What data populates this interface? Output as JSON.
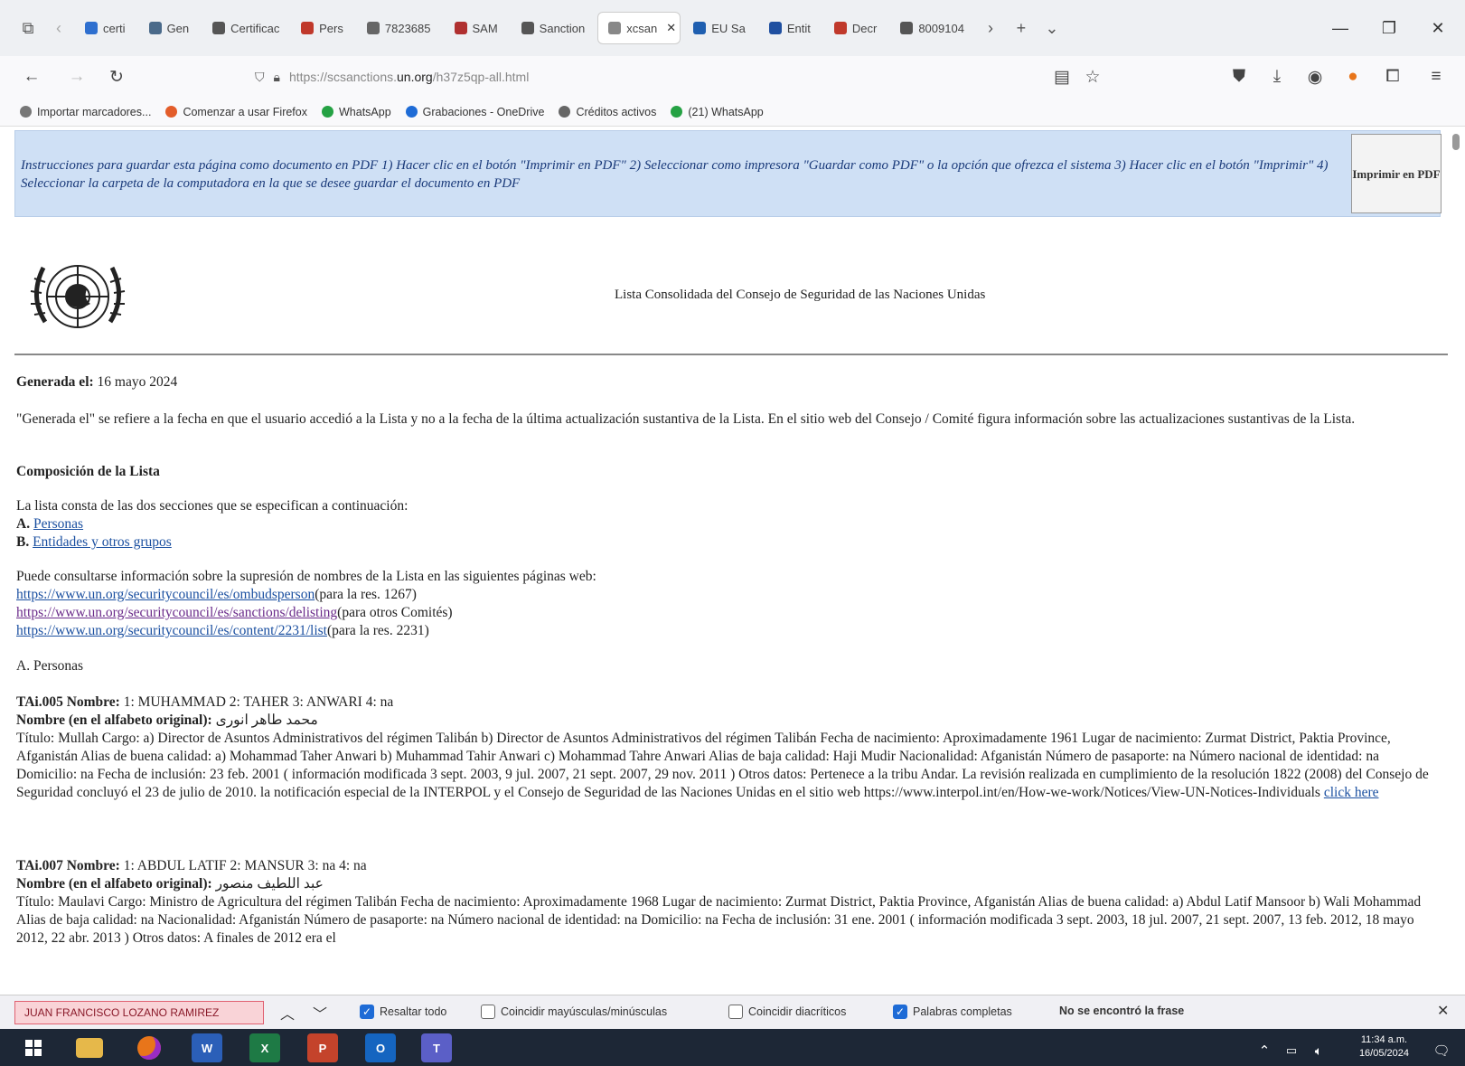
{
  "browser": {
    "tabs": [
      {
        "label": "certi",
        "fav": "#2e6fcf"
      },
      {
        "label": "Gen",
        "fav": "#4a6a8a"
      },
      {
        "label": "Certificac",
        "fav": "#555555"
      },
      {
        "label": "Pers",
        "fav": "#c0392b"
      },
      {
        "label": "7823685",
        "fav": "#666666"
      },
      {
        "label": "SAM",
        "fav": "#b03030"
      },
      {
        "label": "Sanction",
        "fav": "#555555"
      },
      {
        "label": "xcsan",
        "fav": "#888888",
        "active": true
      },
      {
        "label": "EU Sa",
        "fav": "#1f5fb0"
      },
      {
        "label": "Entit",
        "fav": "#1f4fa0"
      },
      {
        "label": "Decr",
        "fav": "#c0392b"
      },
      {
        "label": "8009104",
        "fav": "#555555"
      }
    ],
    "url_prefix": "https://scsanctions.",
    "url_domain": "un.org",
    "url_suffix": "/h37z5qp-all.html",
    "bookmarks": [
      {
        "label": "Importar marcadores...",
        "color": "#777777"
      },
      {
        "label": "Comenzar a usar Firefox",
        "color": "#e35d2a"
      },
      {
        "label": "WhatsApp",
        "color": "#25a244"
      },
      {
        "label": "Grabaciones - OneDrive",
        "color": "#1e6bd6"
      },
      {
        "label": "Créditos activos",
        "color": "#666666"
      },
      {
        "label": "(21) WhatsApp",
        "color": "#25a244"
      }
    ]
  },
  "page": {
    "instructions": "Instrucciones para guardar esta página como documento en PDF 1) Hacer clic en el botón \"Imprimir en PDF\" 2) Seleccionar como impresora \"Guardar como PDF\" o la opción que ofrezca el sistema 3) Hacer clic en el botón \"Imprimir\" 4) Seleccionar la carpeta de la computadora en la que se desee guardar el documento en PDF",
    "print_button": "Imprimir en PDF",
    "title": "Lista Consolidada del Consejo de Seguridad de las Naciones Unidas",
    "generated_label": "Generada el:",
    "generated_value": "16 mayo 2024",
    "generated_note": "\"Generada el\" se refiere a la fecha en que el usuario accedió a la Lista y no a la fecha de la última actualización sustantiva de la Lista. En el sitio web del Consejo / Comité figura información sobre las actualizaciones sustantivas de la Lista.",
    "composition_heading": "Composición de la Lista",
    "composition_intro": "La lista consta de las dos secciones que se especifican a continuación:",
    "section_a_letter": "A.",
    "section_a_link": "Personas",
    "section_b_letter": "B.",
    "section_b_link": "Entidades y otros grupos",
    "removal_intro": "Puede consultarse información sobre la supresión de nombres de la Lista en las siguientes páginas web:",
    "link1": "https://www.un.org/securitycouncil/es/ombudsperson",
    "link1_note": "(para la res. 1267)",
    "link2": "https://www.un.org/securitycouncil/es/sanctions/delisting",
    "link2_note": "(para otros Comités)",
    "link3": "https://www.un.org/securitycouncil/es/content/2231/list",
    "link3_note": "(para la res. 2231)",
    "section_a_heading": "A. Personas",
    "entry1": {
      "head_bold": "TAi.005 Nombre:",
      "head": "1: MUHAMMAD 2: TAHER 3: ANWARI 4: na",
      "orig_label": "Nombre (en el alfabeto original):",
      "orig": "محمد طاهر انوری",
      "body": "Título: Mullah Cargo: a) Director de Asuntos Administrativos del régimen Talibán b) Director de Asuntos Administrativos del régimen Talibán Fecha de nacimiento: Aproximadamente 1961 Lugar de nacimiento: Zurmat District, Paktia Province, Afganistán Alias de buena calidad: a) Mohammad Taher Anwari b) Muhammad Tahir Anwari c) Mohammad Tahre Anwari Alias de baja calidad: Haji Mudir Nacionalidad: Afganistán Número de pasaporte: na Número nacional de identidad: na Domicilio: na Fecha de inclusión: 23 feb. 2001 ( información modificada 3 sept. 2003, 9 jul. 2007, 21 sept. 2007, 29 nov. 2011 ) Otros datos: Pertenece a la tribu Andar. La revisión realizada en cumplimiento de la resolución 1822 (2008) del Consejo de Seguridad concluyó el 23 de julio de 2010. la notificación especial de la INTERPOL y el Consejo de Seguridad de las Naciones Unidas en el sitio web https://www.interpol.int/en/How-we-work/Notices/View-UN-Notices-Individuals",
      "click": "click here"
    },
    "entry2": {
      "head_bold": "TAi.007 Nombre:",
      "head": "1: ABDUL LATIF 2: MANSUR 3: na 4: na",
      "orig_label": "Nombre (en el alfabeto original):",
      "orig": "عبد اللطیف منصور",
      "body": "Título: Maulavi Cargo: Ministro de Agricultura del régimen Talibán Fecha de nacimiento: Aproximadamente 1968 Lugar de nacimiento: Zurmat District, Paktia Province, Afganistán Alias de buena calidad: a) Abdul Latif Mansoor b) Wali Mohammad Alias de baja calidad: na Nacionalidad: Afganistán Número de pasaporte: na Número nacional de identidad: na Domicilio: na Fecha de inclusión: 31 ene. 2001 ( información modificada 3 sept. 2003, 18 jul. 2007, 21 sept. 2007, 13 feb. 2012, 18 mayo 2012, 22 abr. 2013 ) Otros datos: A finales de 2012 era el"
    }
  },
  "findbar": {
    "query": "JUAN FRANCISCO LOZANO RAMIREZ",
    "opt_highlight": "Resaltar todo",
    "opt_case": "Coincidir mayúsculas/minúsculas",
    "opt_diacritics": "Coincidir diacríticos",
    "opt_whole": "Palabras completas",
    "status": "No se encontró la frase"
  },
  "taskbar": {
    "time": "11:34 a.m.",
    "date": "16/05/2024"
  }
}
